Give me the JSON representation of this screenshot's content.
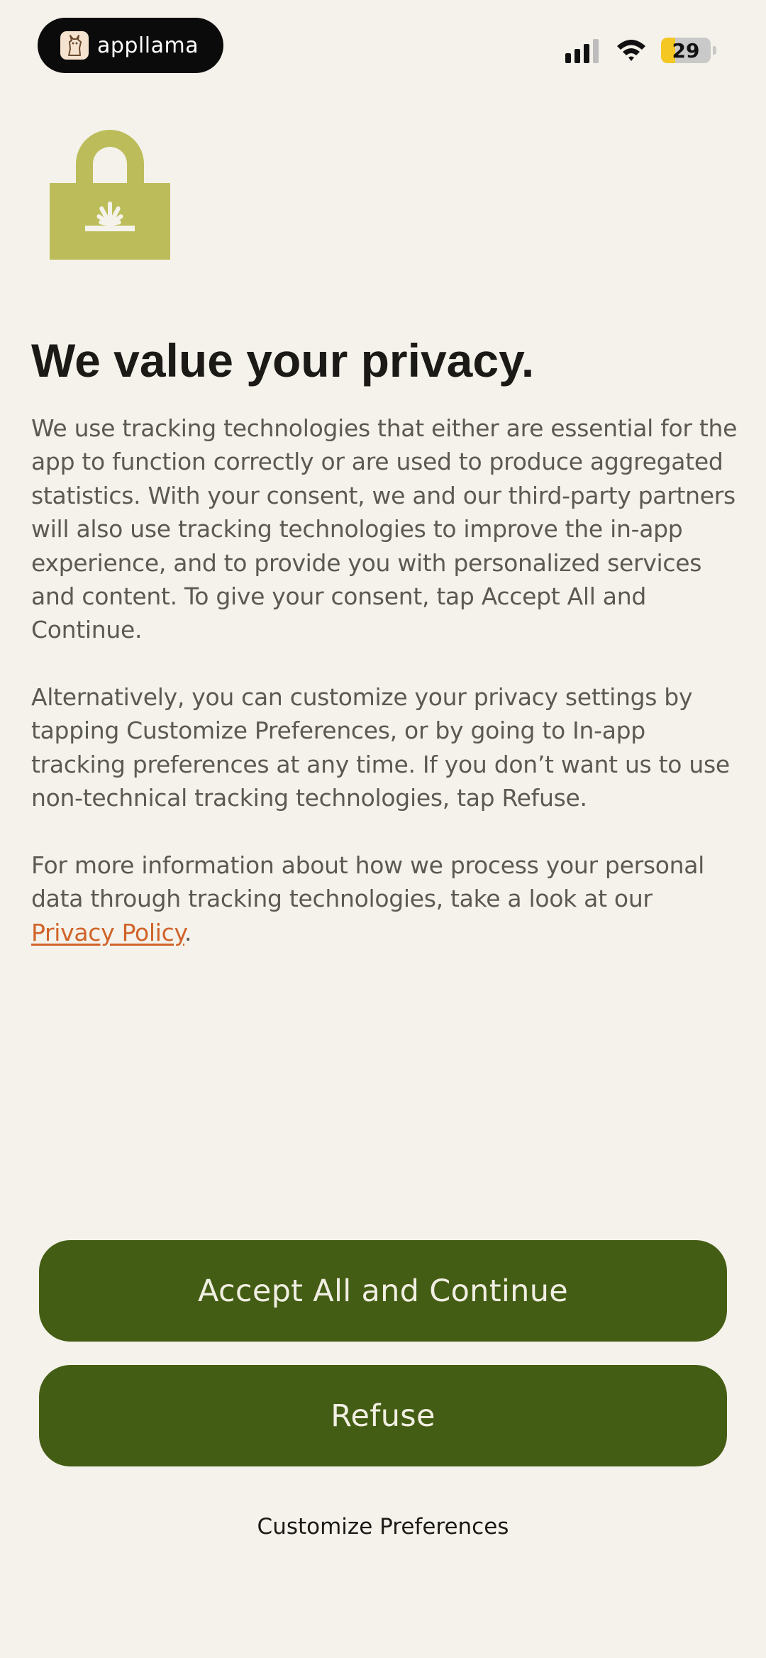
{
  "status_bar": {
    "app_name": "appllama",
    "battery_percent": "29",
    "battery_level": 0.29,
    "signal_bars_active": 3,
    "signal_bars_total": 4,
    "icons": [
      "app-llama-icon",
      "signal-icon",
      "wifi-icon",
      "battery-icon"
    ]
  },
  "logo": {
    "icon": "lock-sunrise-icon",
    "color": "#bcbd5a"
  },
  "privacy": {
    "title": "We value your privacy.",
    "paragraph1": "We use tracking technologies that either are essential for the app to function correctly or are used to produce aggregated statistics. With your consent, we and our third-party partners will also use tracking technologies to improve the in-app experience, and to provide you with personalized services and content. To give your consent, tap Accept All and Continue.",
    "paragraph2": "Alternatively, you can customize your privacy settings by tapping Customize Preferences, or by going to In-app tracking preferences at any time. If you don’t want us to use non-technical tracking technologies, tap Refuse.",
    "paragraph3_before": "For more information about how we process your personal data through tracking technologies, take a look at our ",
    "privacy_policy_link": "Privacy Policy",
    "paragraph3_after": "."
  },
  "actions": {
    "accept_label": "Accept All and Continue",
    "refuse_label": "Refuse",
    "customize_label": "Customize Preferences"
  },
  "colors": {
    "background": "#f4f2ea",
    "button": "#445d14",
    "button_text": "#f1efe3",
    "link": "#d0632a",
    "title": "#1b1a17",
    "body_text": "#5b5953",
    "battery_fill": "#f4c722"
  }
}
